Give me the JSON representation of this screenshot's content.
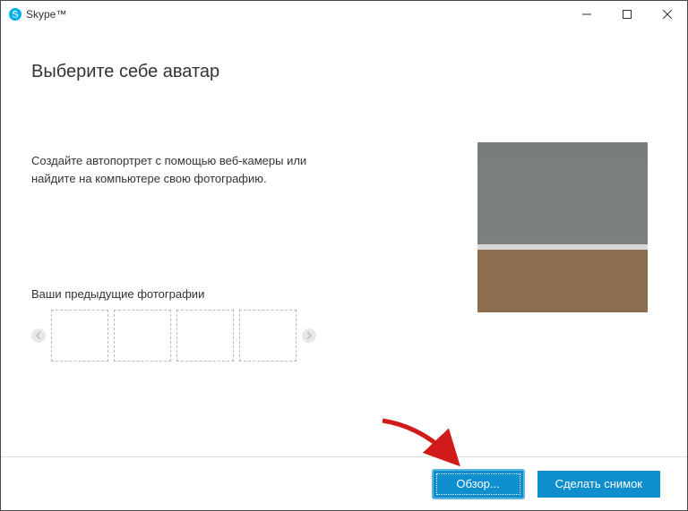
{
  "window": {
    "title": "Skype™"
  },
  "page": {
    "title": "Выберите себе аватар",
    "description": "Создайте автопортрет с помощью веб-камеры или найдите на компьютере свою фотографию.",
    "previousLabel": "Ваши предыдущие фотографии"
  },
  "buttons": {
    "browse": "Обзор...",
    "snapshot": "Сделать снимок"
  },
  "colors": {
    "primary": "#0f8ecd",
    "annotationArrow": "#d11b1b"
  }
}
